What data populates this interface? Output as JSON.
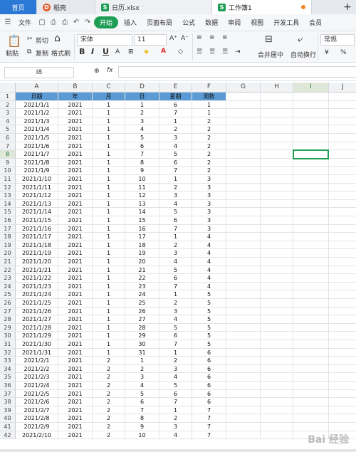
{
  "tabs": [
    {
      "label": "首页",
      "kind": "home"
    },
    {
      "label": "稻壳",
      "kind": "doc"
    },
    {
      "label": "日历.xlsx",
      "kind": "xlsx"
    },
    {
      "label": "工作簿1",
      "kind": "active"
    }
  ],
  "menu": {
    "file": "文件",
    "items": [
      "开始",
      "插入",
      "页面布局",
      "公式",
      "数据",
      "审阅",
      "视图",
      "开发工具",
      "会员"
    ]
  },
  "ribbon": {
    "cut": "剪切",
    "paste": "粘贴",
    "copy": "复制",
    "format_painter": "格式刷",
    "font": "宋体",
    "size": "11",
    "merge": "合并居中",
    "wrap": "自动换行",
    "numfmt": "常规",
    "currency": "¥",
    "percent": "%"
  },
  "formula": {
    "cell": "I8",
    "fx": "fx"
  },
  "columns": [
    "A",
    "B",
    "C",
    "D",
    "E",
    "F",
    "G",
    "H",
    "I",
    "J"
  ],
  "selected_column": "I",
  "selected_row": 8,
  "header": [
    "日期",
    "年",
    "月",
    "日",
    "星期",
    "周数"
  ],
  "rows": [
    [
      "2021/1/1",
      "2021",
      "1",
      "1",
      "6",
      "1"
    ],
    [
      "2021/1/2",
      "2021",
      "1",
      "2",
      "7",
      "1"
    ],
    [
      "2021/1/3",
      "2021",
      "1",
      "3",
      "1",
      "2"
    ],
    [
      "2021/1/4",
      "2021",
      "1",
      "4",
      "2",
      "2"
    ],
    [
      "2021/1/5",
      "2021",
      "1",
      "5",
      "3",
      "2"
    ],
    [
      "2021/1/6",
      "2021",
      "1",
      "6",
      "4",
      "2"
    ],
    [
      "2021/1/7",
      "2021",
      "1",
      "7",
      "5",
      "2"
    ],
    [
      "2021/1/8",
      "2021",
      "1",
      "8",
      "6",
      "2"
    ],
    [
      "2021/1/9",
      "2021",
      "1",
      "9",
      "7",
      "2"
    ],
    [
      "2021/1/10",
      "2021",
      "1",
      "10",
      "1",
      "3"
    ],
    [
      "2021/1/11",
      "2021",
      "1",
      "11",
      "2",
      "3"
    ],
    [
      "2021/1/12",
      "2021",
      "1",
      "12",
      "3",
      "3"
    ],
    [
      "2021/1/13",
      "2021",
      "1",
      "13",
      "4",
      "3"
    ],
    [
      "2021/1/14",
      "2021",
      "1",
      "14",
      "5",
      "3"
    ],
    [
      "2021/1/15",
      "2021",
      "1",
      "15",
      "6",
      "3"
    ],
    [
      "2021/1/16",
      "2021",
      "1",
      "16",
      "7",
      "3"
    ],
    [
      "2021/1/17",
      "2021",
      "1",
      "17",
      "1",
      "4"
    ],
    [
      "2021/1/18",
      "2021",
      "1",
      "18",
      "2",
      "4"
    ],
    [
      "2021/1/19",
      "2021",
      "1",
      "19",
      "3",
      "4"
    ],
    [
      "2021/1/20",
      "2021",
      "1",
      "20",
      "4",
      "4"
    ],
    [
      "2021/1/21",
      "2021",
      "1",
      "21",
      "5",
      "4"
    ],
    [
      "2021/1/22",
      "2021",
      "1",
      "22",
      "6",
      "4"
    ],
    [
      "2021/1/23",
      "2021",
      "1",
      "23",
      "7",
      "4"
    ],
    [
      "2021/1/24",
      "2021",
      "1",
      "24",
      "1",
      "5"
    ],
    [
      "2021/1/25",
      "2021",
      "1",
      "25",
      "2",
      "5"
    ],
    [
      "2021/1/26",
      "2021",
      "1",
      "26",
      "3",
      "5"
    ],
    [
      "2021/1/27",
      "2021",
      "1",
      "27",
      "4",
      "5"
    ],
    [
      "2021/1/28",
      "2021",
      "1",
      "28",
      "5",
      "5"
    ],
    [
      "2021/1/29",
      "2021",
      "1",
      "29",
      "6",
      "5"
    ],
    [
      "2021/1/30",
      "2021",
      "1",
      "30",
      "7",
      "5"
    ],
    [
      "2021/1/31",
      "2021",
      "1",
      "31",
      "1",
      "6"
    ],
    [
      "2021/2/1",
      "2021",
      "2",
      "1",
      "2",
      "6"
    ],
    [
      "2021/2/2",
      "2021",
      "2",
      "2",
      "3",
      "6"
    ],
    [
      "2021/2/3",
      "2021",
      "2",
      "3",
      "4",
      "6"
    ],
    [
      "2021/2/4",
      "2021",
      "2",
      "4",
      "5",
      "6"
    ],
    [
      "2021/2/5",
      "2021",
      "2",
      "5",
      "6",
      "6"
    ],
    [
      "2021/2/6",
      "2021",
      "2",
      "6",
      "7",
      "6"
    ],
    [
      "2021/2/7",
      "2021",
      "2",
      "7",
      "1",
      "7"
    ],
    [
      "2021/2/8",
      "2021",
      "2",
      "8",
      "2",
      "7"
    ],
    [
      "2021/2/9",
      "2021",
      "2",
      "9",
      "3",
      "7"
    ],
    [
      "2021/2/10",
      "2021",
      "2",
      "10",
      "4",
      "7"
    ]
  ],
  "colors": {
    "header_fill": "#5b9bd5",
    "accent": "#1e9e55",
    "home_tab": "#2b79d6"
  }
}
